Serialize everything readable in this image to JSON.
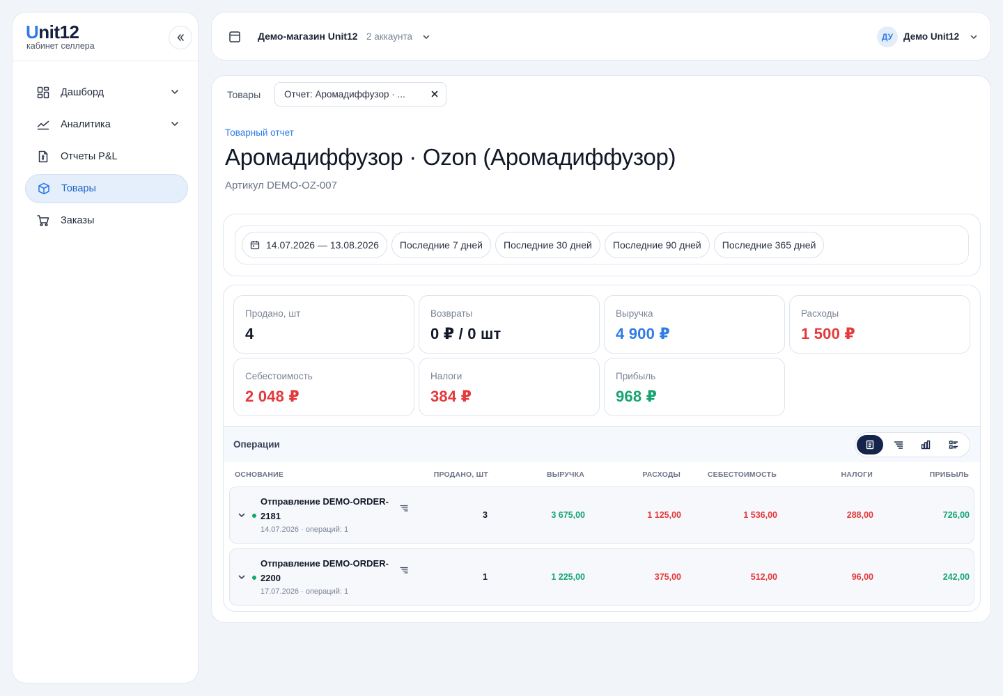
{
  "sidebar": {
    "logo_u": "U",
    "logo_rest": "nit12",
    "subtitle": "кабинет селлера",
    "items": [
      {
        "label": "Дашборд",
        "icon": "dashboard-icon",
        "has_chevron": true
      },
      {
        "label": "Аналитика",
        "icon": "analytics-icon",
        "has_chevron": true
      },
      {
        "label": "Отчеты P&L",
        "icon": "report-icon",
        "has_chevron": false
      },
      {
        "label": "Товары",
        "icon": "box-icon",
        "has_chevron": false,
        "active": true
      },
      {
        "label": "Заказы",
        "icon": "cart-icon",
        "has_chevron": false
      }
    ]
  },
  "topbar": {
    "shop_name": "Демо-магазин Unit12",
    "accounts": "2 аккаунта",
    "avatar_initials": "ДУ",
    "user_name": "Демо Unit12"
  },
  "tabs": {
    "plain": "Товары",
    "active": "Отчет: Аромадиффузор · ..."
  },
  "page": {
    "breadcrumb": "Товарный отчет",
    "title": "Аромадиффузор · Ozon (Аромадиффузор)",
    "sku": "Артикул DEMO-OZ-007"
  },
  "filters": {
    "date_range": "14.07.2026 — 13.08.2026",
    "presets": [
      "Последние 7 дней",
      "Последние 30 дней",
      "Последние 90 дней",
      "Последние 365 дней"
    ]
  },
  "stats": {
    "sold": {
      "label": "Продано, шт",
      "value": "4"
    },
    "returns": {
      "label": "Возвраты",
      "value": "0 ₽ / 0 шт"
    },
    "revenue": {
      "label": "Выручка",
      "value": "4 900 ₽"
    },
    "expenses": {
      "label": "Расходы",
      "value": "1 500 ₽"
    },
    "cost": {
      "label": "Себестоимость",
      "value": "2 048 ₽"
    },
    "taxes": {
      "label": "Налоги",
      "value": "384 ₽"
    },
    "profit": {
      "label": "Прибыль",
      "value": "968 ₽"
    }
  },
  "colors": {
    "accent": "#2f7ce8",
    "positive": "#16a571",
    "negative": "#e5393b",
    "dark_toggle": "#14244a"
  },
  "operations": {
    "title": "Операции",
    "columns": {
      "basis": "Основание",
      "sold": "Продано, шт",
      "revenue": "Выручка",
      "expenses": "Расходы",
      "cost": "Себестоимость",
      "taxes": "Налоги",
      "profit": "Прибыль"
    },
    "rows": [
      {
        "name": "Отправление DEMO-ORDER-2181",
        "meta": "14.07.2026 · операций: 1",
        "sold": "3",
        "revenue": "3 675,00",
        "expenses": "1 125,00",
        "cost": "1 536,00",
        "taxes": "288,00",
        "profit": "726,00"
      },
      {
        "name": "Отправление DEMO-ORDER-2200",
        "meta": "17.07.2026 · операций: 1",
        "sold": "1",
        "revenue": "1 225,00",
        "expenses": "375,00",
        "cost": "512,00",
        "taxes": "96,00",
        "profit": "242,00"
      }
    ]
  }
}
